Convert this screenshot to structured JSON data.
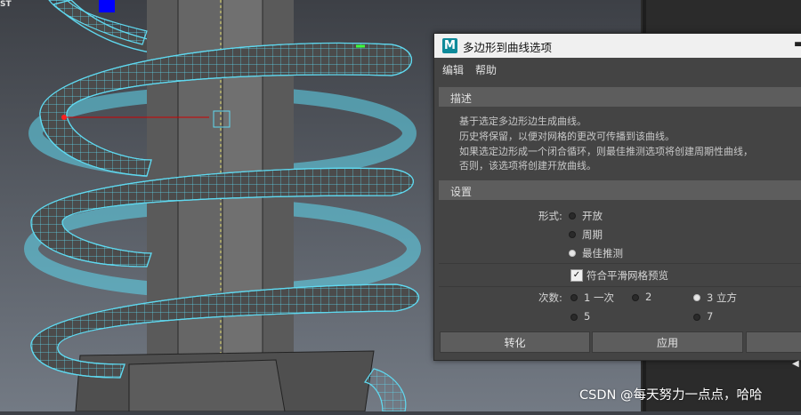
{
  "viewport": {
    "bg_top": "#3d4046",
    "bg_bottom": "#737a84",
    "corner_label": "ST",
    "coil_color": "#5fd9f0",
    "manipulator_color": "#0000ff"
  },
  "dialog": {
    "app_icon_letter": "M",
    "title": "多边形到曲线选项",
    "menu": {
      "edit": "编辑",
      "help": "帮助"
    },
    "description": {
      "header": "描述",
      "lines": [
        "基于选定多边形边生成曲线。",
        "历史将保留，以便对网格的更改可传播到该曲线。",
        "如果选定边形成一个闭合循环，则最佳推测选项将创建周期性曲线，",
        "否则，该选项将创建开放曲线。"
      ]
    },
    "settings": {
      "header": "设置",
      "form": {
        "label": "形式:",
        "options": [
          "开放",
          "周期",
          "最佳推测"
        ],
        "selected": "最佳推测"
      },
      "smooth_preview": {
        "label": "符合平滑网格预览",
        "checked": true
      },
      "degree": {
        "label": "次数:",
        "options": [
          "1 一次",
          "2",
          "3 立方",
          "5",
          "7"
        ],
        "selected": "3 立方"
      }
    },
    "buttons": {
      "apply_close": "转化",
      "apply": "应用",
      "close": ""
    },
    "accent": "#0e8a9a"
  },
  "watermark": "CSDN @每天努力一点点，哈哈"
}
